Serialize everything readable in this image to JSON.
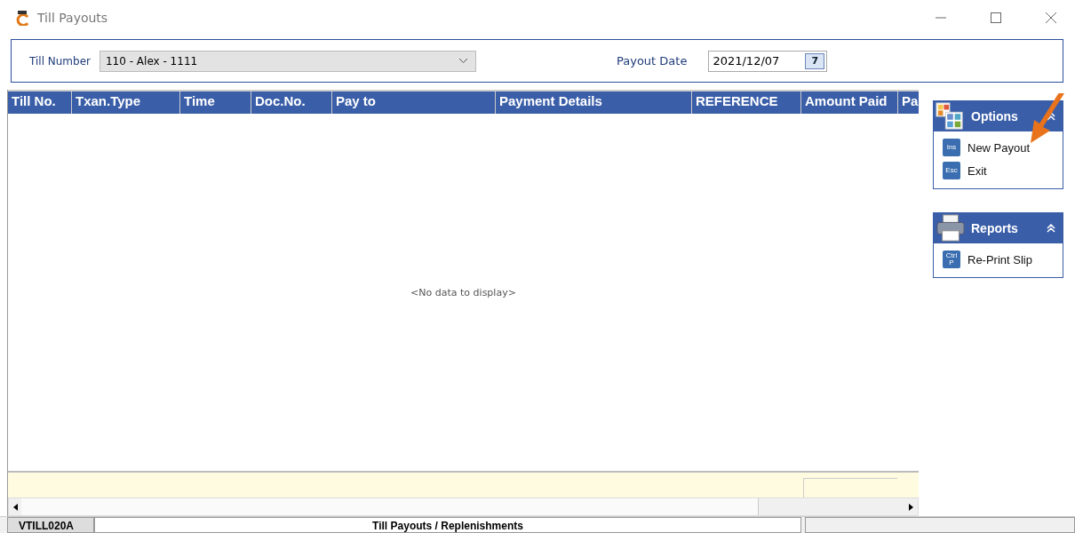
{
  "window": {
    "title": "Till Payouts"
  },
  "filter": {
    "till_label": "Till Number",
    "till_value": "110 - Alex - 1111",
    "date_label": "Payout Date",
    "date_value": "2021/12/07",
    "calendar_icon_text": "7"
  },
  "table": {
    "columns": [
      "Till No.",
      "Txan.Type",
      "Time",
      "Doc.No.",
      "Pay to",
      "Payment Details",
      "REFERENCE",
      "Amount Paid",
      "Pa"
    ],
    "empty_text": "<No data to display>"
  },
  "panels": [
    {
      "title": "Options",
      "kind": "options",
      "expanded": true,
      "items": [
        {
          "key": "Ins",
          "label": "New Payout"
        },
        {
          "key": "Esc",
          "label": "Exit"
        }
      ]
    },
    {
      "title": "Reports",
      "kind": "printer",
      "expanded": true,
      "items": [
        {
          "key": "Ctrl P",
          "label": "Re-Print Slip"
        }
      ]
    }
  ],
  "status_bar": {
    "code": "VTILL020A",
    "title": "Till Payouts / Replenishments"
  }
}
